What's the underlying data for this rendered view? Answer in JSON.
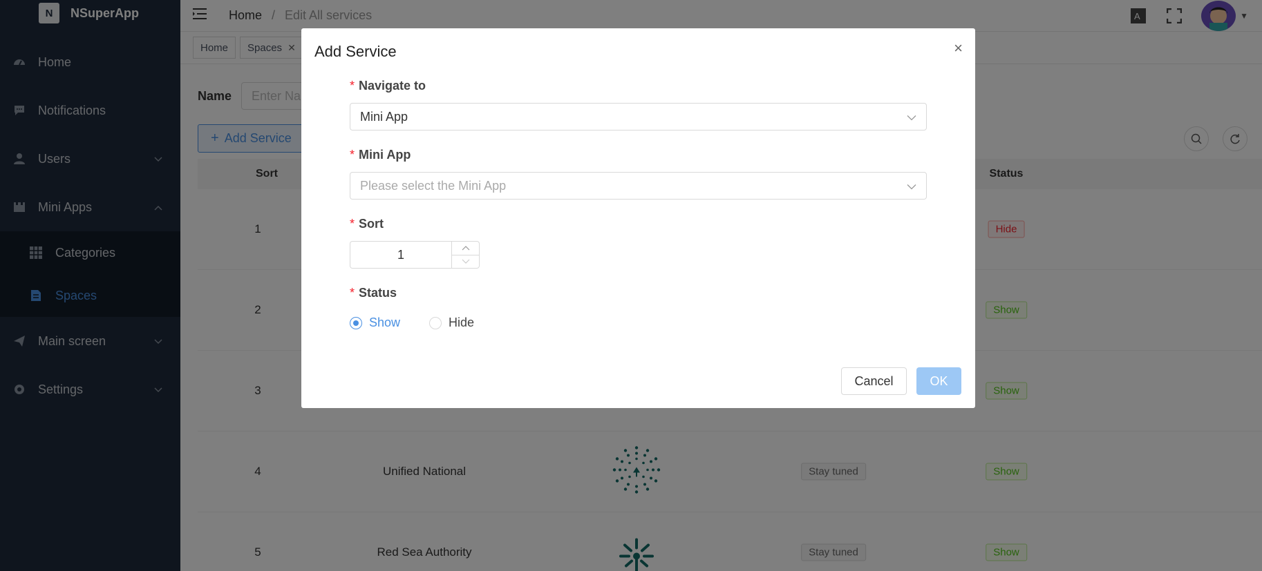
{
  "app": {
    "name": "NSuperApp",
    "logo_letter": "N"
  },
  "sidebar": {
    "items": [
      {
        "label": "Home",
        "icon": "dashboard-icon"
      },
      {
        "label": "Notifications",
        "icon": "message-icon"
      },
      {
        "label": "Users",
        "icon": "user-icon"
      },
      {
        "label": "Mini Apps",
        "icon": "folder-icon"
      },
      {
        "label": "Main screen",
        "icon": "send-icon"
      },
      {
        "label": "Settings",
        "icon": "gear-icon"
      }
    ],
    "sub_items": [
      {
        "label": "Categories",
        "icon": "grid-icon"
      },
      {
        "label": "Spaces",
        "icon": "doc-icon"
      }
    ]
  },
  "breadcrumb": {
    "home": "Home",
    "sep": "/",
    "current": "Edit All services"
  },
  "tags": [
    {
      "label": "Home"
    },
    {
      "label": "Spaces"
    }
  ],
  "filter": {
    "label": "Name",
    "placeholder": "Enter Nar"
  },
  "toolbar": {
    "add_label": "Add Service"
  },
  "table": {
    "headers": {
      "sort": "Sort",
      "status": "Status"
    },
    "rows": [
      {
        "sort": "1",
        "name": "",
        "state": "",
        "status": "Hide"
      },
      {
        "sort": "2",
        "name": "",
        "state": "",
        "status": "Show"
      },
      {
        "sort": "3",
        "name": "",
        "state": "",
        "status": "Show"
      },
      {
        "sort": "4",
        "name": "Unified National",
        "state": "Stay tuned",
        "status": "Show"
      },
      {
        "sort": "5",
        "name": "Red Sea Authority",
        "state": "Stay tuned",
        "status": "Show"
      }
    ]
  },
  "modal": {
    "title": "Add Service",
    "close": "×",
    "navigate_label": "Navigate to",
    "navigate_value": "Mini App",
    "miniapp_label": "Mini App",
    "miniapp_placeholder": "Please select the Mini App",
    "sort_label": "Sort",
    "sort_value": "1",
    "status_label": "Status",
    "status_options": [
      "Show",
      "Hide"
    ],
    "status_selected": "Show",
    "cancel_label": "Cancel",
    "ok_label": "OK",
    "required_mark": "*"
  },
  "colors": {
    "accent": "#4a90e2",
    "sidebar": "#1f2b3c",
    "required": "#f5222d"
  }
}
